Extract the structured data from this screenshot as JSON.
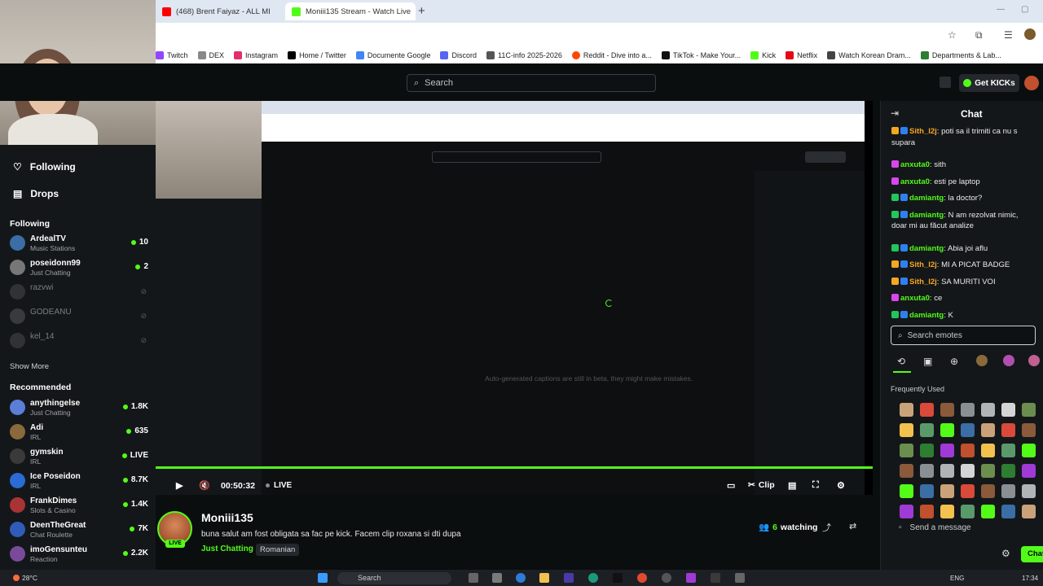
{
  "browser": {
    "tabs": [
      {
        "label": "(468) Brent Faiyaz - ALL MI",
        "favicon_color": "#ff0000"
      },
      {
        "label": "Moniii135 Stream - Watch Live",
        "favicon_color": "#53fc18"
      }
    ],
    "bookmarks": [
      {
        "label": "Twitch",
        "color": "#9146ff"
      },
      {
        "label": "DEX",
        "color": "#888888"
      },
      {
        "label": "Instagram",
        "color": "#e1306c"
      },
      {
        "label": "Home / Twitter",
        "color": "#000000"
      },
      {
        "label": "Documente Google",
        "color": "#4285f4"
      },
      {
        "label": "Discord",
        "color": "#5865f2"
      },
      {
        "label": "11C-info 2025-2026",
        "color": "#555555"
      },
      {
        "label": "Reddit - Dive into a...",
        "color": "#ff4500"
      },
      {
        "label": "TikTok - Make Your...",
        "color": "#111111"
      },
      {
        "label": "Kick",
        "color": "#53fc18"
      },
      {
        "label": "Netflix",
        "color": "#e50914"
      },
      {
        "label": "Watch Korean Dram...",
        "color": "#444444"
      },
      {
        "label": "Departments & Lab...",
        "color": "#2e7d32"
      }
    ]
  },
  "header": {
    "search_placeholder": "Search",
    "get_kicks_label": "Get KICKs"
  },
  "sidebar": {
    "nav": [
      {
        "label": "Following",
        "icon": "heart-icon"
      },
      {
        "label": "Drops",
        "icon": "drops-icon"
      }
    ],
    "following_heading": "Following",
    "following": [
      {
        "name": "ArdealTV",
        "category": "Music Stations",
        "viewers": "10",
        "live": true,
        "color": "#3a6ea5"
      },
      {
        "name": "poseidonn99",
        "category": "Just Chatting",
        "viewers": "2",
        "live": true,
        "color": "#777777"
      },
      {
        "name": "razvwi",
        "category": "",
        "viewers": "",
        "live": false,
        "color": "#555555"
      },
      {
        "name": "GODEANU",
        "category": "",
        "viewers": "",
        "live": false,
        "color": "#666666"
      },
      {
        "name": "kel_14",
        "category": "",
        "viewers": "",
        "live": false,
        "color": "#555555"
      }
    ],
    "show_more": "Show More",
    "recommended_heading": "Recommended",
    "recommended": [
      {
        "name": "anythingelse",
        "category": "Just Chatting",
        "viewers": "1.8K",
        "color": "#5b7fd6"
      },
      {
        "name": "Adi",
        "category": "IRL",
        "viewers": "635",
        "color": "#8a6a3a"
      },
      {
        "name": "gymskin",
        "category": "IRL",
        "viewers": "LIVE",
        "color": "#3a3a3a"
      },
      {
        "name": "Ice Poseidon",
        "category": "IRL",
        "viewers": "8.7K",
        "color": "#2a6bd6"
      },
      {
        "name": "FrankDimes",
        "category": "Slots & Casino",
        "viewers": "1.4K",
        "color": "#a33"
      },
      {
        "name": "DeenTheGreat",
        "category": "Chat Roulette",
        "viewers": "7K",
        "color": "#2e5cb8"
      },
      {
        "name": "imoGensunteu",
        "category": "Reaction",
        "viewers": "2.2K",
        "color": "#7a4a9a"
      }
    ]
  },
  "player": {
    "caption": "Auto-generated captions are still in beta, they might make mistakes.",
    "timecode": "00:50:32",
    "live_label": "LIVE",
    "clip_label": "Clip"
  },
  "stream": {
    "streamer": "Moniii135",
    "live_pill": "LIVE",
    "title": "buna salut am fost obligata sa fac pe kick. Facem clip roxana si dti dupa",
    "category": "Just Chatting",
    "language": "Romanian",
    "watching_count": "6",
    "watching_label": "watching"
  },
  "chat": {
    "title": "Chat",
    "messages": [
      {
        "user": "Sith_l2j",
        "user_color": "#f5a623",
        "text": "poti sa il trimiti ca nu s",
        "badges": [
          "#f5a623",
          "#2f80ed"
        ]
      },
      {
        "user": "",
        "user_color": "#eaeaea",
        "text": "supara",
        "badges": []
      },
      {
        "user": "anxuta0",
        "user_color": "#53fc18",
        "text": "sith",
        "badges": [
          "#d946ef"
        ]
      },
      {
        "user": "anxuta0",
        "user_color": "#53fc18",
        "text": "esti pe laptop",
        "badges": [
          "#d946ef"
        ]
      },
      {
        "user": "damiantg",
        "user_color": "#53fc18",
        "text": "la doctor?",
        "badges": [
          "#22c55e",
          "#2f80ed"
        ]
      },
      {
        "user": "damiantg",
        "user_color": "#53fc18",
        "text": "N am rezolvat nimic,",
        "badges": [
          "#22c55e",
          "#2f80ed"
        ]
      },
      {
        "user": "",
        "user_color": "#eaeaea",
        "text": "doar mi au făcut analize",
        "badges": []
      },
      {
        "user": "damiantg",
        "user_color": "#53fc18",
        "text": "Abia joi aflu",
        "badges": [
          "#22c55e",
          "#2f80ed"
        ]
      },
      {
        "user": "Sith_l2j",
        "user_color": "#f5a623",
        "text": "MI A PICAT BADGE",
        "badges": [
          "#f5a623",
          "#2f80ed"
        ]
      },
      {
        "user": "Sith_l2j",
        "user_color": "#f5a623",
        "text": "SA MURITI VOI",
        "badges": [
          "#f5a623",
          "#2f80ed"
        ]
      },
      {
        "user": "anxuta0",
        "user_color": "#53fc18",
        "text": "ce",
        "badges": [
          "#d946ef"
        ]
      },
      {
        "user": "damiantg",
        "user_color": "#53fc18",
        "text": "K",
        "badges": [
          "#22c55e",
          "#2f80ed"
        ]
      }
    ],
    "emote_search_placeholder": "Search emotes",
    "frequently_used_label": "Frequently Used",
    "send_placeholder": "Send a message",
    "chat_button_label": "Chat"
  },
  "taskbar": {
    "weather": "28°C",
    "search_placeholder": "Search",
    "language": "ENG",
    "time": "17:34"
  }
}
